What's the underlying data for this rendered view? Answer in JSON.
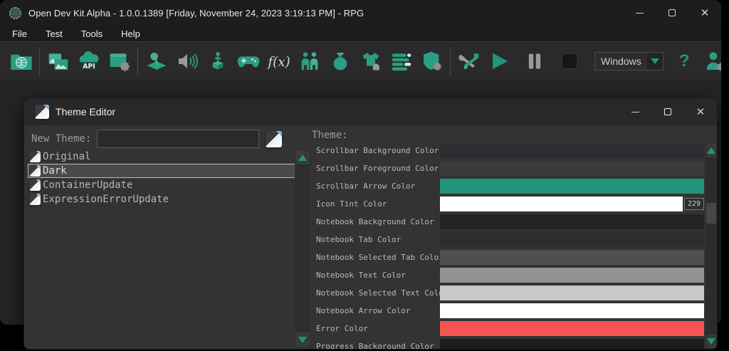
{
  "colors": {
    "accent_teal": "#21957a",
    "toolbar_icon_teal": "#2a9e83",
    "error_red": "#f75454",
    "selection_gray": "#4a4a4a"
  },
  "main_window": {
    "title": "Open Dev Kit Alpha - 1.0.0.1389 [Friday, November 24, 2023 3:19:13 PM] - RPG",
    "menus": [
      "File",
      "Test",
      "Tools",
      "Help"
    ],
    "toolbar": {
      "icon_names": [
        "screenshot-folder-icon",
        "images-icon",
        "api-icon",
        "window-settings-icon",
        "map-icon",
        "audio-icon",
        "character-icon",
        "gamepad-icon",
        "function-icon",
        "people-icon",
        "currency-icon",
        "equipment-icon",
        "levels-icon",
        "security-icon",
        "build-tools-icon",
        "play-icon",
        "pause-icon",
        "stop-icon",
        "platform-dropdown",
        "help-icon",
        "account-settings-icon"
      ],
      "platform_dropdown_value": "Windows",
      "help_label": "?"
    }
  },
  "theme_editor": {
    "title": "Theme Editor",
    "new_theme_label": "New Theme:",
    "new_theme_value": "",
    "theme_section_label": "Theme:",
    "themes": [
      {
        "name": "Original",
        "selected": false
      },
      {
        "name": "Dark",
        "selected": true
      },
      {
        "name": "ContainerUpdate",
        "selected": false
      },
      {
        "name": "ExpressionErrorUpdate",
        "selected": false
      }
    ],
    "properties": [
      {
        "label": "Scrollbar Background Color",
        "color": "#2d2d31"
      },
      {
        "label": "Scrollbar Foreground Color",
        "color": "#3b3b3b"
      },
      {
        "label": "Scrollbar Arrow Color",
        "color": "#21957a"
      },
      {
        "label": "Icon Tint Color",
        "color": "#ffffff",
        "value": "229"
      },
      {
        "label": "Notebook Background Color",
        "color": "#242424"
      },
      {
        "label": "Notebook Tab Color",
        "color": "#2d2d2d"
      },
      {
        "label": "Notebook Selected Tab Color",
        "color": "#4f4f4f"
      },
      {
        "label": "Notebook Text Color",
        "color": "#929292"
      },
      {
        "label": "Notebook Selected Text Color",
        "color": "#c8c8c8"
      },
      {
        "label": "Notebook Arrow Color",
        "color": "#ffffff"
      },
      {
        "label": "Error Color",
        "color": "#f75454"
      },
      {
        "label": "Progress Background Color",
        "color": "#1d1d1d"
      }
    ]
  }
}
